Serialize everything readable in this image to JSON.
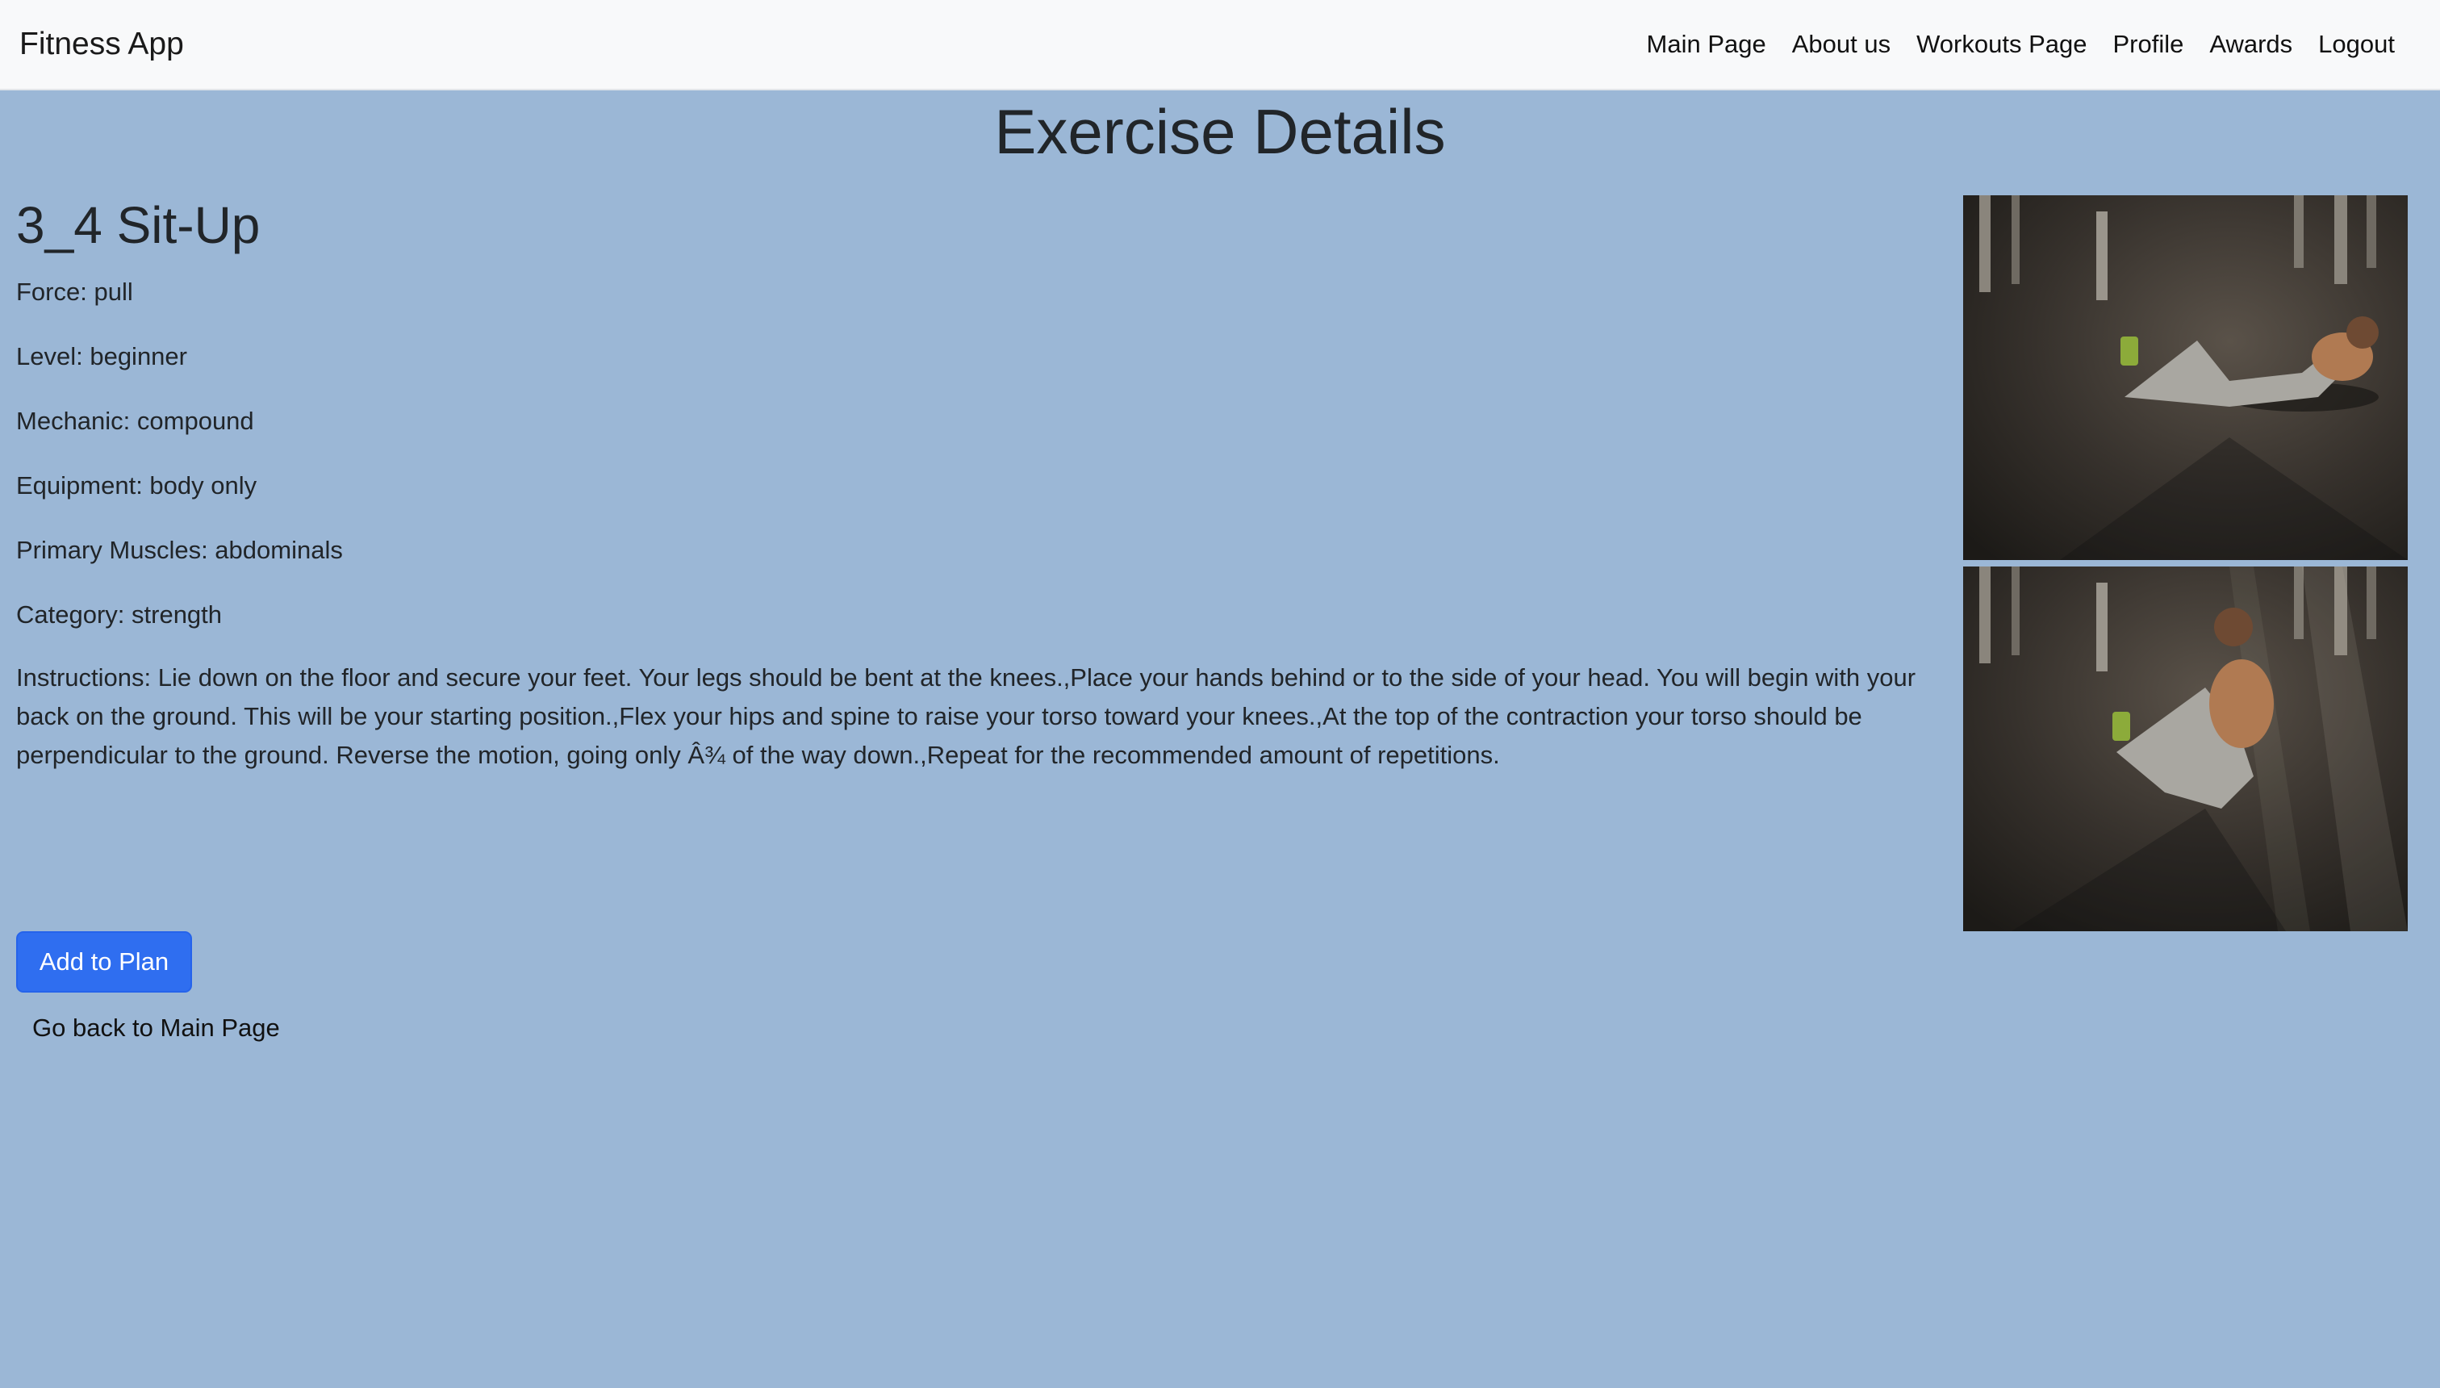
{
  "navbar": {
    "brand": "Fitness App",
    "links": [
      {
        "label": "Main Page"
      },
      {
        "label": "About us"
      },
      {
        "label": "Workouts Page"
      },
      {
        "label": "Profile"
      },
      {
        "label": "Awards"
      },
      {
        "label": "Logout"
      }
    ]
  },
  "page": {
    "title": "Exercise Details"
  },
  "exercise": {
    "name": "3_4 Sit-Up",
    "force": "Force: pull",
    "level": "Level: beginner",
    "mechanic": "Mechanic: compound",
    "equipment": "Equipment: body only",
    "primary_muscles": "Primary Muscles: abdominals",
    "category": "Category: strength",
    "instructions": "Instructions: Lie down on the floor and secure your feet. Your legs should be bent at the knees.,Place your hands behind or to the side of your head. You will begin with your back on the ground. This will be your starting position.,Flex your hips and spine to raise your torso toward your knees.,At the top of the contraction your torso should be perpendicular to the ground. Reverse the motion, going only Â¾ of the way down.,Repeat for the recommended amount of repetitions."
  },
  "actions": {
    "add_to_plan": "Add to Plan",
    "go_back": "Go back to Main Page"
  },
  "colors": {
    "background": "#9bb7d6",
    "navbar": "#f8f9fa",
    "primary_button": "#2f6ef0"
  }
}
